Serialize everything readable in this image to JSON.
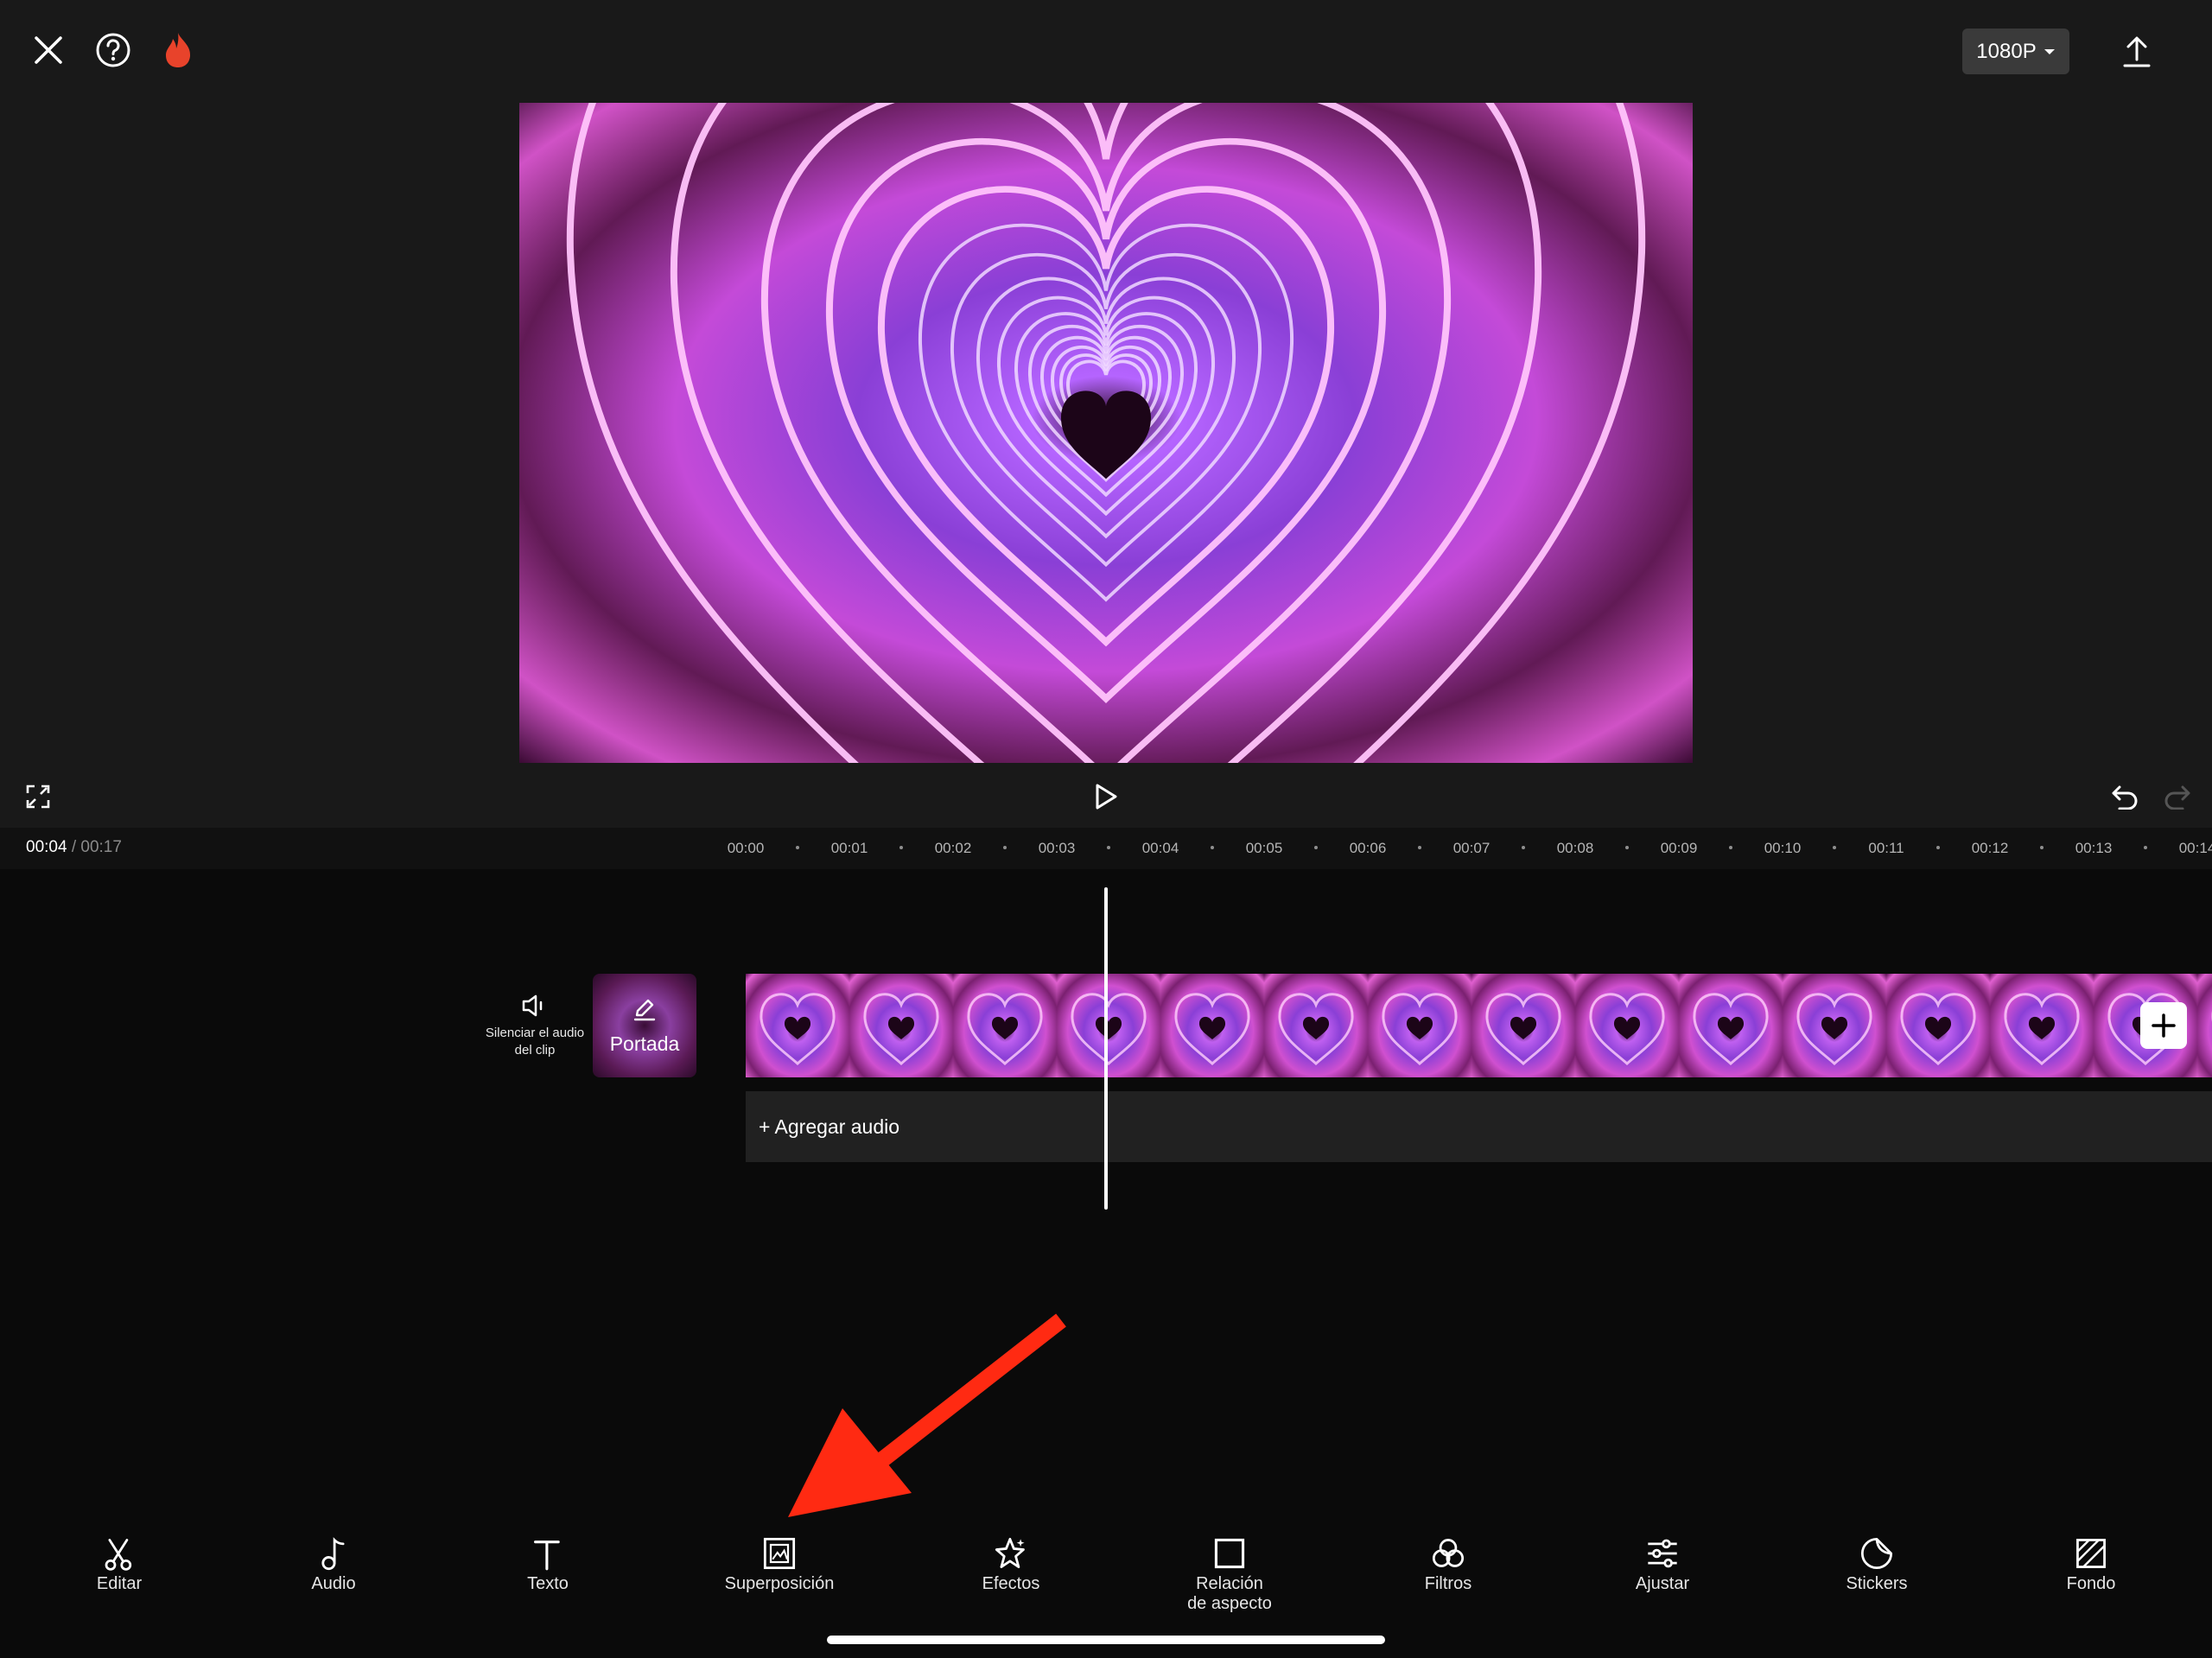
{
  "header": {
    "resolution_label": "1080P",
    "icons": [
      "close-icon",
      "help-icon",
      "flame-icon",
      "export-icon"
    ]
  },
  "player": {
    "current_time": "00:04",
    "separator": "/",
    "total_time": "00:17"
  },
  "ruler": {
    "ticks": [
      "00:00",
      "00:01",
      "00:02",
      "00:03",
      "00:04",
      "00:05",
      "00:06",
      "00:07",
      "00:08",
      "00:09",
      "00:10",
      "00:11",
      "00:12",
      "00:13",
      "00:14"
    ]
  },
  "timeline": {
    "mute_label": "Silenciar el audio del clip",
    "cover_label": "Portada",
    "add_audio_label": "+ Agregar audio"
  },
  "toolbar": {
    "items": [
      {
        "label": "Editar",
        "icon": "scissors-icon"
      },
      {
        "label": "Audio",
        "icon": "music-note-icon"
      },
      {
        "label": "Texto",
        "icon": "text-icon"
      },
      {
        "label": "Superposición",
        "icon": "overlay-icon"
      },
      {
        "label": "Efectos",
        "icon": "effects-star-icon"
      },
      {
        "label": "Relación\nde aspecto",
        "icon": "aspect-ratio-icon"
      },
      {
        "label": "Filtros",
        "icon": "filters-icon"
      },
      {
        "label": "Ajustar",
        "icon": "adjust-sliders-icon"
      },
      {
        "label": "Stickers",
        "icon": "sticker-icon"
      },
      {
        "label": "Fondo",
        "icon": "background-icon"
      }
    ]
  },
  "colors": {
    "accent_arrow": "#ff2a12",
    "flame": "#e8432b",
    "panel": "#191919",
    "background": "#0a0a0a"
  }
}
